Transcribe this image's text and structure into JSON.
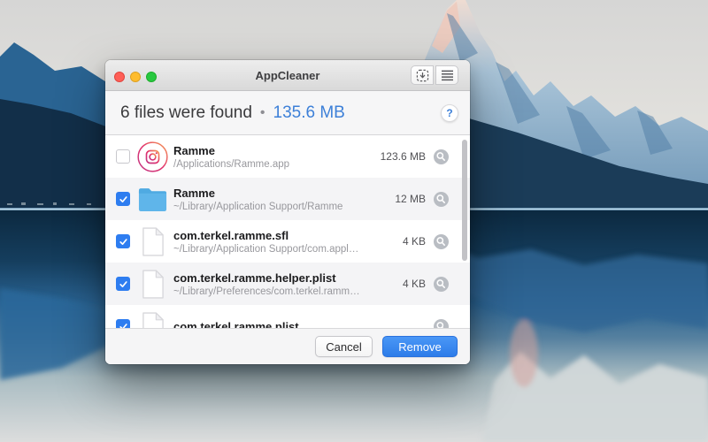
{
  "window": {
    "title": "AppCleaner",
    "toolbar": {
      "drop_button_icon": "drop-app-target-icon",
      "list_button_icon": "list-icon"
    }
  },
  "header": {
    "summary": "6 files were found",
    "separator": "•",
    "total_size": "135.6 MB",
    "help_label": "?"
  },
  "files": [
    {
      "name": "Ramme",
      "path": "/Applications/Ramme.app",
      "size": "123.6 MB",
      "checked": false,
      "icon": "app"
    },
    {
      "name": "Ramme",
      "path": "~/Library/Application Support/Ramme",
      "size": "12 MB",
      "checked": true,
      "icon": "folder"
    },
    {
      "name": "com.terkel.ramme.sfl",
      "path": "~/Library/Application Support/com.apple.shar…",
      "size": "4 KB",
      "checked": true,
      "icon": "file"
    },
    {
      "name": "com.terkel.ramme.helper.plist",
      "path": "~/Library/Preferences/com.terkel.ramme.help…",
      "size": "4 KB",
      "checked": true,
      "icon": "file"
    },
    {
      "name": "com.terkel.ramme.plist",
      "path": "",
      "size": "",
      "checked": true,
      "icon": "file"
    }
  ],
  "footer": {
    "cancel_label": "Cancel",
    "remove_label": "Remove"
  },
  "colors": {
    "accent": "#3d80d8",
    "checkbox": "#2e7df0",
    "remove-top": "#4a97f6",
    "remove-bottom": "#2d7ce9",
    "folder": "#5fb5ea"
  }
}
